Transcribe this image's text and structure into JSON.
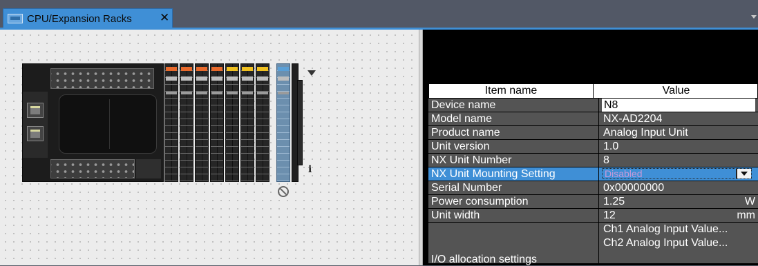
{
  "tab": {
    "label": "CPU/Expansion Racks",
    "close": "✕",
    "icon": "rack-tab-icon"
  },
  "rack": {
    "slot_caps": [
      "#e86a2c",
      "#e86a2c",
      "#e86a2c",
      "#e86a2c",
      "#f0c020",
      "#f0c020",
      "#f0c020",
      "#5a9fd6"
    ],
    "info_glyph": "i"
  },
  "properties": {
    "header": {
      "name": "Item name",
      "value": "Value"
    },
    "device_name": {
      "label": "Device name",
      "value": "N8"
    },
    "model_name": {
      "label": "Model name",
      "value": "NX-AD2204"
    },
    "product_name": {
      "label": "Product name",
      "value": "Analog Input Unit"
    },
    "unit_version": {
      "label": "Unit version",
      "value": "1.0"
    },
    "unit_number": {
      "label": "NX Unit Number",
      "value": "8"
    },
    "mounting": {
      "label": "NX Unit Mounting Setting",
      "value": "Disabled"
    },
    "serial": {
      "label": "Serial Number",
      "value": "0x00000000"
    },
    "power": {
      "label": "Power consumption",
      "value": "1.25",
      "unit": "W"
    },
    "width": {
      "label": "Unit width",
      "value": "12",
      "unit": "mm"
    },
    "io": {
      "label": "I/O allocation settings",
      "items": [
        "Ch1 Analog Input Value...",
        "Ch2 Analog Input Value..."
      ]
    }
  },
  "colors": {
    "accent": "#3f8fd6",
    "row_bg": "#545454"
  }
}
